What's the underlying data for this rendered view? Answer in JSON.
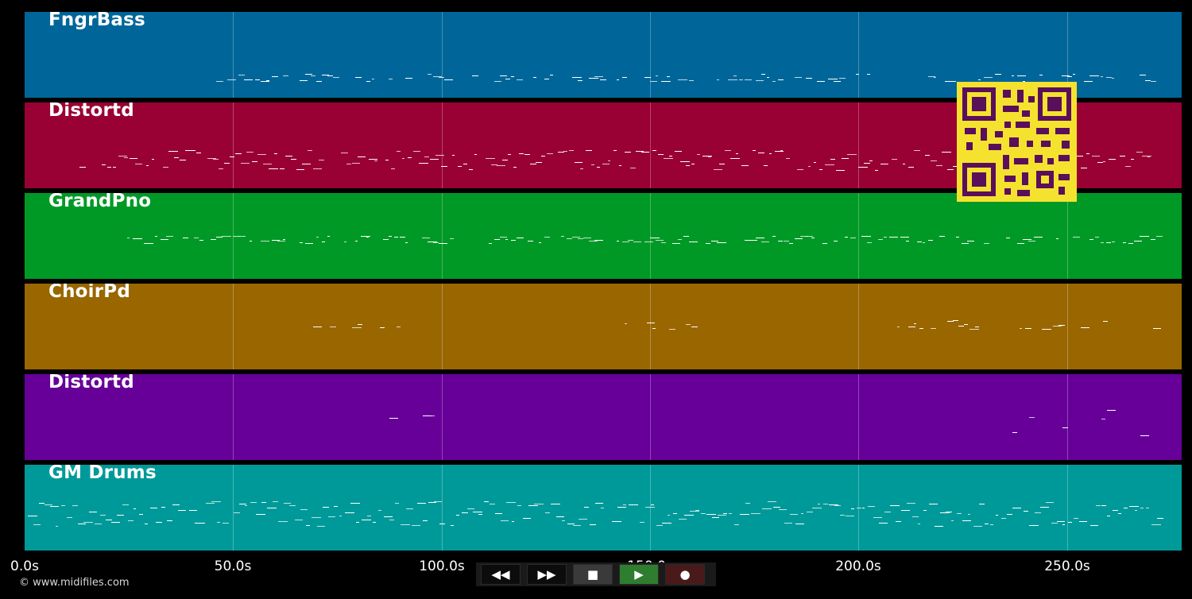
{
  "tracks": [
    {
      "label": "FngrBass",
      "color": "#006699"
    },
    {
      "label": "Distortd",
      "color": "#990033"
    },
    {
      "label": "GrandPno",
      "color": "#009926"
    },
    {
      "label": "ChoirPd",
      "color": "#996600"
    },
    {
      "label": "Distortd",
      "color": "#660099"
    },
    {
      "label": "GM Drums",
      "color": "#009999"
    }
  ],
  "timeline": {
    "ticks": [
      "0.0s",
      "50.0s",
      "100.0s",
      "150.0s",
      "200.0s",
      "250.0s"
    ]
  },
  "transport": {
    "rewind_icon": "rewind-icon",
    "fast_forward_icon": "fast-forward-icon",
    "stop_icon": "stop-icon",
    "play_icon": "play-icon",
    "record_icon": "record-icon"
  },
  "footer": {
    "copyright": "© www.midifiles.com"
  },
  "qr": {
    "icon": "qr-code",
    "colors": {
      "background": "#f5e22f",
      "module": "#5a0f5a"
    }
  }
}
